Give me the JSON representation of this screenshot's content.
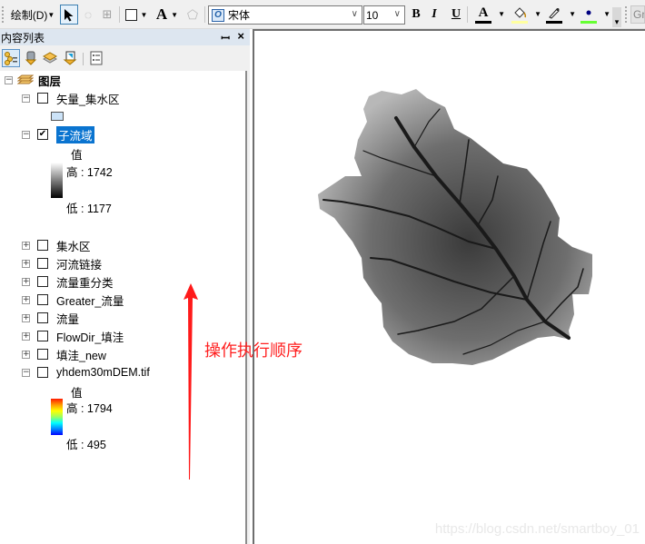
{
  "toolbar": {
    "draw_menu_label": "绘制(D)",
    "font_name": "宋体",
    "font_size": "10",
    "bold_label": "B",
    "italic_label": "I",
    "underline_label": "U",
    "font_color_glyph": "A",
    "text_tool_glyph": "A",
    "next_toolbar_label": "Gr",
    "colors": {
      "font_color": "#000000",
      "fill_color": "#ffffa0",
      "line_color": "#000000",
      "marker_color": "#66ff33"
    }
  },
  "toc": {
    "title": "内容列表",
    "pin_glyph": "ᚠ",
    "close_glyph": "×",
    "root_label": "图层",
    "layers": [
      {
        "name": "矢量_集水区",
        "checked": false,
        "expanded": true,
        "legend": {
          "type": "polygon",
          "fill": "#cce3f8"
        }
      },
      {
        "name": "子流域",
        "checked": true,
        "expanded": true,
        "selected": true,
        "legend": {
          "type": "stretch",
          "title": "值",
          "high": "高 : 1742",
          "low": "低 : 1177",
          "ramp": "grayscale"
        }
      },
      {
        "name": "集水区",
        "checked": false,
        "expanded": false
      },
      {
        "name": "河流链接",
        "checked": false,
        "expanded": false
      },
      {
        "name": "流量重分类",
        "checked": false,
        "expanded": false
      },
      {
        "name": "Greater_流量",
        "checked": false,
        "expanded": false
      },
      {
        "name": "流量",
        "checked": false,
        "expanded": false
      },
      {
        "name": "FlowDir_填洼",
        "checked": false,
        "expanded": false
      },
      {
        "name": "填洼_new",
        "checked": false,
        "expanded": false
      },
      {
        "name": "yhdem30mDEM.tif",
        "checked": false,
        "expanded": true,
        "legend": {
          "type": "stretch",
          "title": "值",
          "high": "高 : 1794",
          "low": "低 : 495",
          "ramp": "spectrum"
        }
      }
    ]
  },
  "annotation": {
    "text": "操作执行顺序",
    "color": "#ff2020"
  },
  "map": {
    "watermark": "https://blog.csdn.net/smartboy_01"
  }
}
